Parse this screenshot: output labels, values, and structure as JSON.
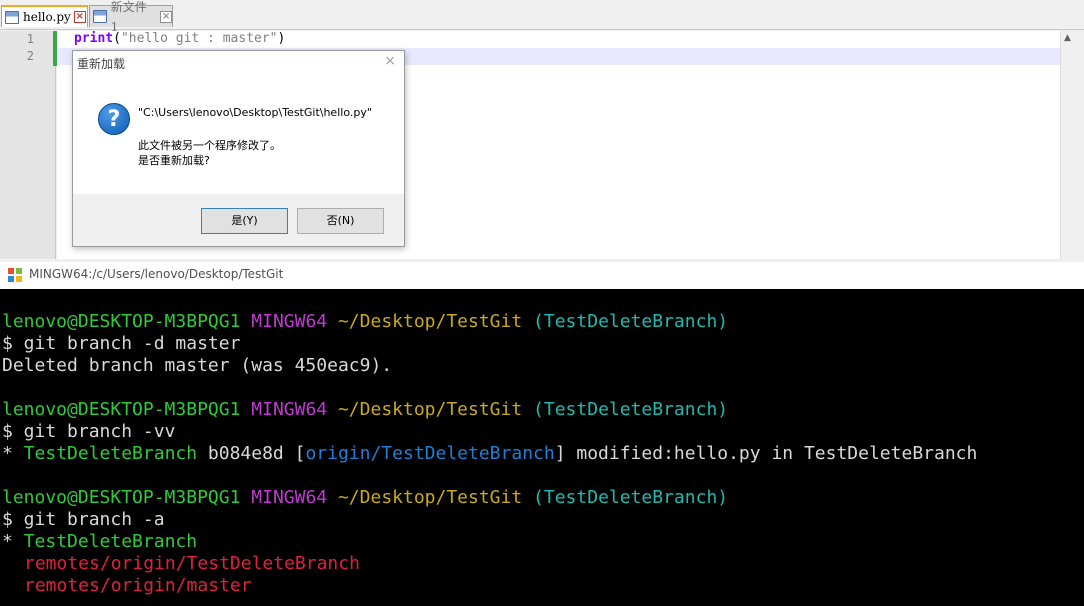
{
  "editor": {
    "tabs": [
      {
        "label": "hello.py",
        "active": true
      },
      {
        "label": "新文件 1",
        "active": false
      }
    ],
    "line_numbers": [
      "1",
      "2"
    ],
    "code": {
      "keyword": "print",
      "open": "(",
      "string": "\"hello git : master\"",
      "close": ")"
    }
  },
  "dialog": {
    "title": "重新加载",
    "close_glyph": "×",
    "question_glyph": "?",
    "path": "\"C:\\Users\\lenovo\\Desktop\\TestGit\\hello.py\"",
    "message1": "此文件被另一个程序修改了。",
    "message2": "是否重新加载?",
    "yes_label": "是(Y)",
    "no_label": "否(N)"
  },
  "terminal": {
    "title": "MINGW64:/c/Users/lenovo/Desktop/TestGit",
    "prompt": {
      "user": "lenovo@DESKTOP-M3BPQG1",
      "env": "MINGW64",
      "path": "~/Desktop/TestGit",
      "branch": "(TestDeleteBranch)"
    },
    "blocks": [
      {
        "command": "$ git branch -d master",
        "output": "Deleted branch master (was 450eac9)."
      },
      {
        "command": "$ git branch -vv",
        "star": "* ",
        "branch": "TestDeleteBranch",
        "hash": " b084e8d [",
        "upstream": "origin/TestDeleteBranch",
        "rest": "] modified:hello.py in TestDeleteBranch"
      },
      {
        "command": "$ git branch -a",
        "star": "* ",
        "branch": "TestDeleteBranch",
        "remote1": "remotes/origin/TestDeleteBranch",
        "remote2": "remotes/origin/master"
      }
    ]
  },
  "colors": {
    "user": "#2fcb3a",
    "env": "#c03bd1",
    "path": "#c9a81e",
    "branch": "#1ebab0",
    "remote": "#e0213c",
    "upstream": "#1e7fd6"
  }
}
